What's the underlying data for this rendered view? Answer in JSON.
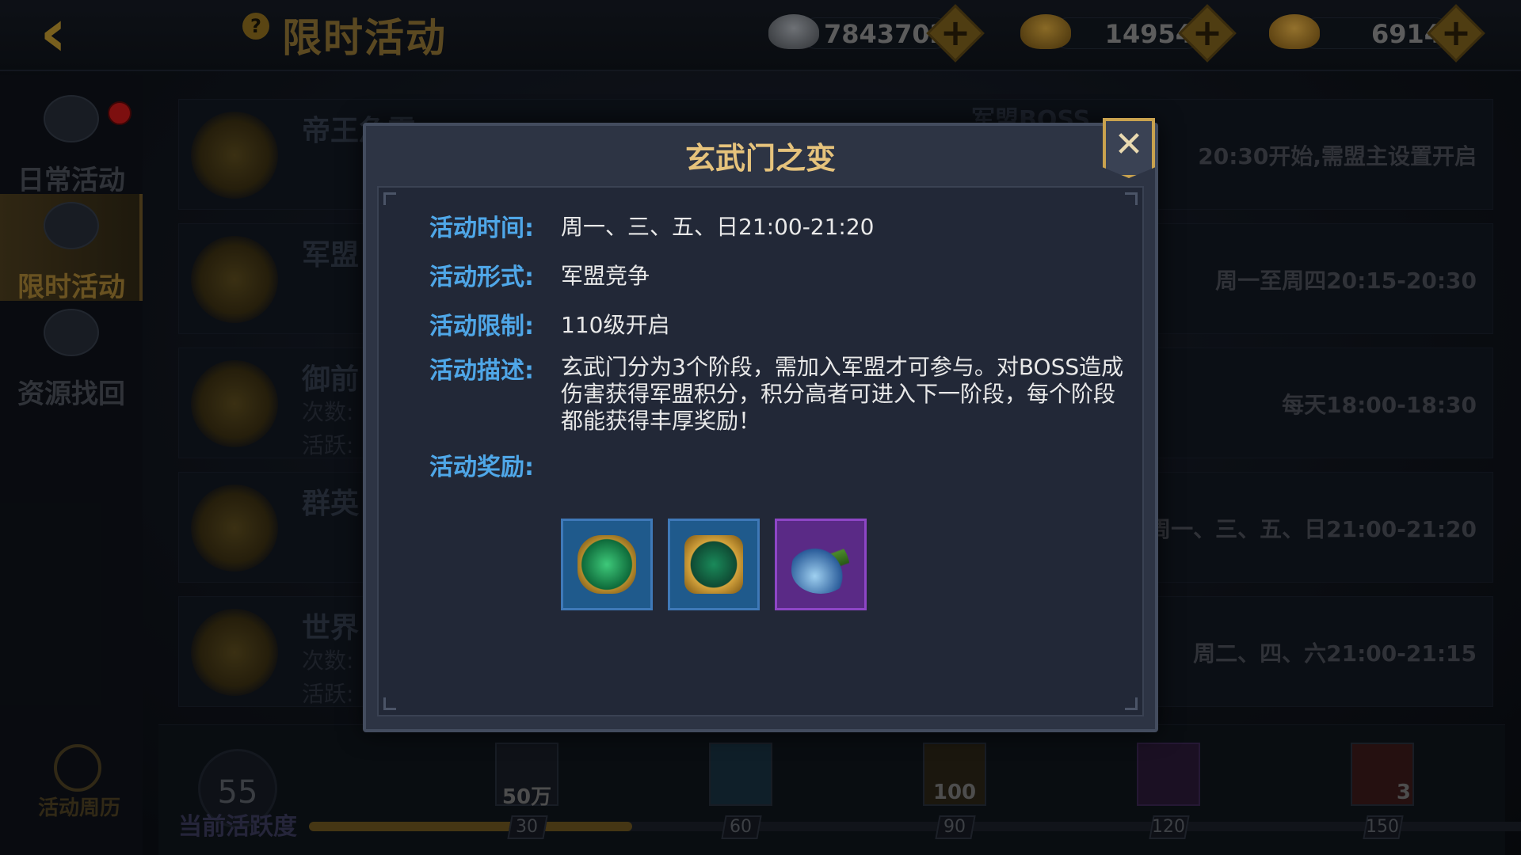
{
  "topbar": {
    "title": "限时活动",
    "help_icon": "?",
    "back_icon": "‹",
    "currencies": [
      {
        "icon": "silver-ingot-icon",
        "value": "78437023",
        "color": "#8a8f96"
      },
      {
        "icon": "gold-ingot-icon",
        "value": "14954",
        "color": "#b88a2a"
      },
      {
        "icon": "yuanbao-icon",
        "value": "6914",
        "color": "#c69a32"
      }
    ],
    "plus_label": "+"
  },
  "sidebar": {
    "tabs": [
      {
        "label": "日常活动",
        "icon": "helmet-icon",
        "active": false,
        "badge": true
      },
      {
        "label": "限时活动",
        "icon": "helmet-clock-icon",
        "active": true,
        "badge": false
      },
      {
        "label": "资源找回",
        "icon": "ingot-icon",
        "active": false,
        "badge": false
      }
    ],
    "calendar_label": "活动周历"
  },
  "activities": [
    {
      "name": "帝王急需",
      "sub": "",
      "right_name": "军盟BOSS",
      "time": "20:30开始,需盟主设置开启"
    },
    {
      "name": "军盟",
      "sub": "",
      "right_name": "",
      "time": "周一至周四20:15-20:30"
    },
    {
      "name": "御前",
      "sub": "次数:\n活跃:",
      "right_name": "",
      "time": "每天18:00-18:30"
    },
    {
      "name": "群英",
      "sub": "",
      "right_name": "",
      "time": "周一、三、五、日21:00-21:20"
    },
    {
      "name": "世界",
      "sub": "次数:\n活跃:",
      "right_name": "",
      "time": "周二、四、六21:00-21:15"
    }
  ],
  "activity_bar": {
    "current": "55",
    "label": "当前活跃度",
    "progress": 0.255,
    "milestones": [
      {
        "threshold": "30",
        "qty": "50万",
        "icon": "silver-icon"
      },
      {
        "threshold": "60",
        "qty": "",
        "icon": "book-icon"
      },
      {
        "threshold": "90",
        "qty": "100",
        "icon": "dragon-icon"
      },
      {
        "threshold": "120",
        "qty": "",
        "icon": "purple-book-icon"
      },
      {
        "threshold": "150",
        "qty": "3",
        "icon": "scroll-icon"
      }
    ]
  },
  "modal": {
    "title": "玄武门之变",
    "close_icon": "✕",
    "fields": {
      "time_label": "活动时间:",
      "time_value": "周一、三、五、日21:00-21:20",
      "form_label": "活动形式:",
      "form_value": "军盟竞争",
      "limit_label": "活动限制:",
      "limit_value": "110级开启",
      "desc_label": "活动描述:",
      "desc_value": "玄武门分为3个阶段，需加入军盟才可参与。对BOSS造成伤害获得军盟积分，积分高者可进入下一阶段，每个阶段都能获得丰厚奖励！",
      "reward_label": "活动奖励:"
    },
    "rewards": [
      {
        "icon": "jade-token-icon",
        "bg": "#1f5a8c"
      },
      {
        "icon": "gold-medal-icon",
        "bg": "#1f5a8c"
      },
      {
        "icon": "vase-icon",
        "bg": "#5a2a86"
      }
    ]
  }
}
